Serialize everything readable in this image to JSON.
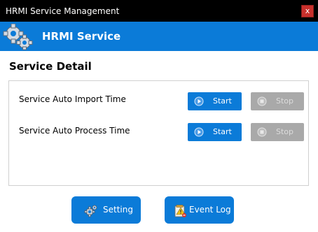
{
  "window": {
    "title": "HRMI Service Management",
    "close_glyph": "x"
  },
  "banner": {
    "title": "HRMI Service",
    "icon": "gears-icon"
  },
  "section": {
    "title": "Service Detail"
  },
  "services": [
    {
      "label": "Service Auto Import Time",
      "start_label": "Start",
      "stop_label": "Stop"
    },
    {
      "label": "Service Auto Process Time",
      "start_label": "Start",
      "stop_label": "Stop"
    }
  ],
  "footer": {
    "setting_label": "Setting",
    "event_log_label": "Event Log"
  },
  "colors": {
    "accent": "#0b7bd8",
    "titlebar": "#000000",
    "close": "#c9302c",
    "disabled": "#a9a9a9"
  }
}
